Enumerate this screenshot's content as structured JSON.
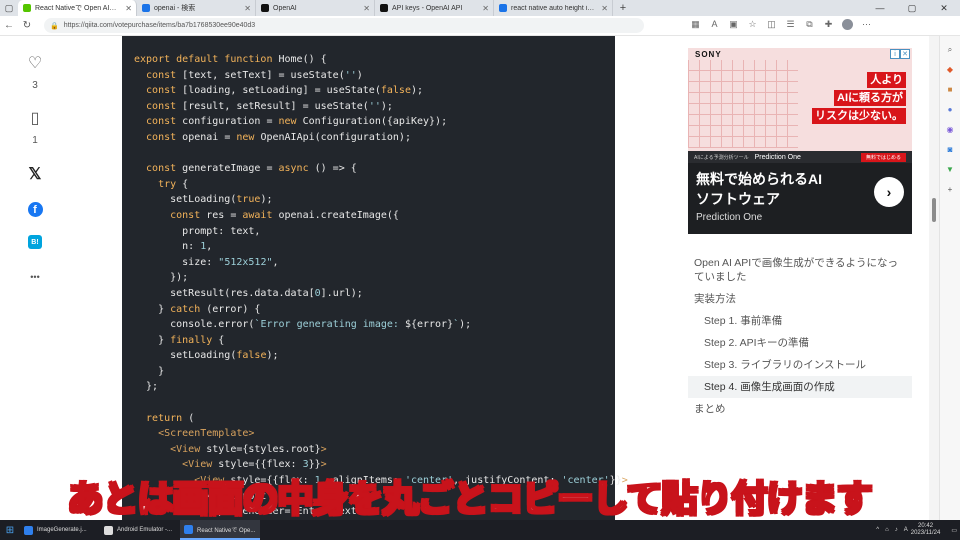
{
  "tabs": [
    {
      "title": "React Nativeで Open AIを使用して画像生成",
      "color": "#55c500",
      "active": true
    },
    {
      "title": "openai - 検索",
      "color": "#1a73e8",
      "active": false
    },
    {
      "title": "OpenAI",
      "color": "#111111",
      "active": false
    },
    {
      "title": "API keys - OpenAI API",
      "color": "#111111",
      "active": false
    },
    {
      "title": "react native auto height image",
      "color": "#1a73e8",
      "active": false
    }
  ],
  "address": {
    "url": "https://qiita.com/votepurchase/items/ba7b1768530ee90e40d3"
  },
  "sidebar": {
    "like_count": "3",
    "stock_count": "1",
    "hatena_label": "B!",
    "more_label": "•••"
  },
  "code_lines": [
    [
      [
        "kw",
        "export default function "
      ],
      [
        "fn",
        "Home() {"
      ]
    ],
    [
      [
        "kw",
        "  const "
      ],
      [
        "fn",
        "[text, setText] = useState("
      ],
      [
        "str",
        "''"
      ],
      [
        "fn",
        ")"
      ]
    ],
    [
      [
        "kw",
        "  const "
      ],
      [
        "fn",
        "[loading, setLoading] = useState("
      ],
      [
        "kw",
        "false"
      ],
      [
        "fn",
        ");"
      ]
    ],
    [
      [
        "kw",
        "  const "
      ],
      [
        "fn",
        "[result, setResult] = useState("
      ],
      [
        "str",
        "''"
      ],
      [
        "fn",
        ");"
      ]
    ],
    [
      [
        "kw",
        "  const "
      ],
      [
        "fn",
        "configuration = "
      ],
      [
        "kw",
        "new "
      ],
      [
        "fn",
        "Configuration({apiKey});"
      ]
    ],
    [
      [
        "kw",
        "  const "
      ],
      [
        "fn",
        "openai = "
      ],
      [
        "kw",
        "new "
      ],
      [
        "fn",
        "OpenAIApi(configuration);"
      ]
    ],
    [
      [
        "fn",
        ""
      ]
    ],
    [
      [
        "kw",
        "  const "
      ],
      [
        "fn",
        "generateImage = "
      ],
      [
        "kw",
        "async "
      ],
      [
        "fn",
        "() => {"
      ]
    ],
    [
      [
        "kw",
        "    try "
      ],
      [
        "fn",
        "{"
      ]
    ],
    [
      [
        "fn",
        "      setLoading("
      ],
      [
        "kw",
        "true"
      ],
      [
        "fn",
        ");"
      ]
    ],
    [
      [
        "kw",
        "      const "
      ],
      [
        "fn",
        "res = "
      ],
      [
        "kw",
        "await "
      ],
      [
        "fn",
        "openai.createImage({"
      ]
    ],
    [
      [
        "fn",
        "        prompt: text,"
      ]
    ],
    [
      [
        "fn",
        "        n: "
      ],
      [
        "num",
        "1"
      ],
      [
        "fn",
        ","
      ]
    ],
    [
      [
        "fn",
        "        size: "
      ],
      [
        "str",
        "\"512x512\""
      ],
      [
        "fn",
        ","
      ]
    ],
    [
      [
        "fn",
        "      });"
      ]
    ],
    [
      [
        "fn",
        "      setResult(res.data.data["
      ],
      [
        "num",
        "0"
      ],
      [
        "fn",
        "].url);"
      ]
    ],
    [
      [
        "fn",
        "    } "
      ],
      [
        "kw",
        "catch "
      ],
      [
        "fn",
        "(error) {"
      ]
    ],
    [
      [
        "fn",
        "      console.error("
      ],
      [
        "str",
        "`Error generating image: "
      ],
      [
        "fn",
        "${error}"
      ],
      [
        "str",
        "`"
      ],
      [
        "fn",
        ");"
      ]
    ],
    [
      [
        "fn",
        "    } "
      ],
      [
        "kw",
        "finally "
      ],
      [
        "fn",
        "{"
      ]
    ],
    [
      [
        "fn",
        "      setLoading("
      ],
      [
        "kw",
        "false"
      ],
      [
        "fn",
        ");"
      ]
    ],
    [
      [
        "fn",
        "    }"
      ]
    ],
    [
      [
        "fn",
        "  };"
      ]
    ],
    [
      [
        "fn",
        ""
      ]
    ],
    [
      [
        "kw",
        "  return "
      ],
      [
        "fn",
        "("
      ]
    ],
    [
      [
        "tag",
        "    <ScreenTemplate>"
      ]
    ],
    [
      [
        "tag",
        "      <View "
      ],
      [
        "fn",
        "style={styles.root}"
      ],
      [
        "tag",
        ">"
      ]
    ],
    [
      [
        "tag",
        "        <View "
      ],
      [
        "fn",
        "style={{flex: "
      ],
      [
        "num",
        "3"
      ],
      [
        "fn",
        "}}"
      ],
      [
        "tag",
        ">"
      ]
    ],
    [
      [
        "tag",
        "          <View "
      ],
      [
        "fn",
        "style={{flex: "
      ],
      [
        "num",
        "1"
      ],
      [
        "fn",
        ", alignItems: "
      ],
      [
        "str",
        "'center'"
      ],
      [
        "fn",
        ", justifyContent: "
      ],
      [
        "str",
        "'center'"
      ],
      [
        "fn",
        "}}"
      ],
      [
        "tag",
        ">"
      ]
    ],
    [
      [
        "fn",
        "            <TextInput"
      ]
    ],
    [
      [
        "fn",
        "              placeholder=\"Enter text\""
      ]
    ]
  ],
  "ad": {
    "brand": "SONY",
    "catch_lines": [
      "人より",
      "AIに頼る方が",
      "リスクは少ない。"
    ],
    "mid_text": "AIによる予測分析ツール",
    "product": "Prediction One",
    "cta": "無料ではじめる",
    "headline1": "無料で始められるAI",
    "headline2": "ソフトウェア",
    "tagline": "Prediction One",
    "arrow": "›"
  },
  "toc": [
    {
      "label": "Open AI APIで画像生成ができるようになっていました",
      "level": 1,
      "active": false
    },
    {
      "label": "実装方法",
      "level": 1,
      "active": false
    },
    {
      "label": "Step 1. 事前準備",
      "level": 2,
      "active": false
    },
    {
      "label": "Step 2. APIキーの準備",
      "level": 2,
      "active": false
    },
    {
      "label": "Step 3. ライブラリのインストール",
      "level": 2,
      "active": false
    },
    {
      "label": "Step 4. 画像生成画面の作成",
      "level": 2,
      "active": true
    },
    {
      "label": "まとめ",
      "level": 1,
      "active": false
    }
  ],
  "subtitle": "あとは画面の中身を丸ごとコピーして貼り付けます",
  "taskbar": {
    "items": [
      {
        "label": "ImageGenerate.j...",
        "color": "#2f80ed",
        "active": false
      },
      {
        "label": "Android Emulator -...",
        "color": "#dddddd",
        "active": false
      },
      {
        "label": "React Nativeで Ope...",
        "color": "#2f80ed",
        "active": true
      }
    ],
    "time": "20:42",
    "date": "2023/11/24"
  }
}
